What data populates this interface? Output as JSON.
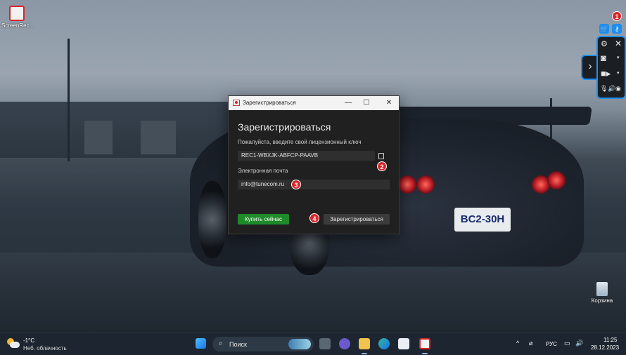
{
  "desktop": {
    "icons": [
      {
        "label": "ScreenRec..."
      },
      {
        "label": "Корзина"
      }
    ]
  },
  "recorder": {
    "badges": [
      "1",
      "2",
      "3",
      "4"
    ]
  },
  "dialog": {
    "window_title": "Зарегистрироваться",
    "heading": "Зарегистрироваться",
    "license_label": "Пожалуйста, введите свой лицензионный ключ",
    "license_value": "REC1-WBXJK-ABFCP-PAAVB",
    "email_label": "Электронная почта",
    "email_value": "info@tunecom.ru",
    "buy_button": "Купить сейчас",
    "register_button": "Зарегистрироваться"
  },
  "taskbar": {
    "weather_temp": "-1°C",
    "weather_desc": "Неб. облачность",
    "search_placeholder": "Поиск",
    "language": "РУС",
    "time": "11:25",
    "date": "28.12.2023"
  },
  "colors": {
    "accent": "#1e8ef0",
    "badge": "#d6262b",
    "buy_green": "#1f8a29"
  }
}
